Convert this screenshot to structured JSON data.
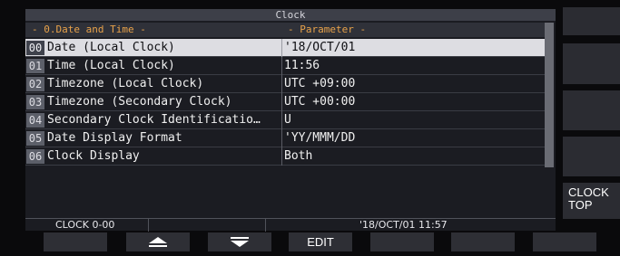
{
  "window": {
    "title": "Clock"
  },
  "table": {
    "col_name_header": "- 0.Date and Time -",
    "col_value_header": "- Parameter -",
    "rows": [
      {
        "num": "00",
        "name": "Date (Local Clock)",
        "value": "'18/OCT/01"
      },
      {
        "num": "01",
        "name": "Time (Local Clock)",
        "value": "11:56"
      },
      {
        "num": "02",
        "name": "Timezone (Local Clock)",
        "value": "UTC +09:00"
      },
      {
        "num": "03",
        "name": "Timezone (Secondary Clock)",
        "value": "UTC +00:00"
      },
      {
        "num": "04",
        "name": "Secondary Clock Identificatio…",
        "value": "U"
      },
      {
        "num": "05",
        "name": "Date Display Format",
        "value": "'YY/MMM/DD"
      },
      {
        "num": "06",
        "name": "Clock Display",
        "value": "Both"
      }
    ]
  },
  "status": {
    "menu_id": "CLOCK 0-00",
    "datetime": "'18/OCT/01   11:57"
  },
  "side_keys": {
    "clock_top": "CLOCK TOP"
  },
  "function_keys": {
    "up_icon": "triangle-up-icon",
    "down_icon": "triangle-down-icon",
    "edit": "EDIT"
  },
  "colors": {
    "header_text": "#e8a24a",
    "selected_row": "#dddde2",
    "panel": "#1b1c22"
  }
}
